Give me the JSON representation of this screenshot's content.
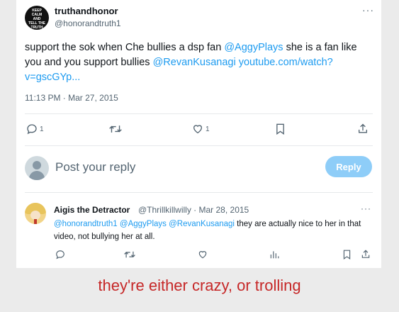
{
  "tweet": {
    "avatar_lines": [
      "KEEP",
      "CALM",
      "AND",
      "TELL THE",
      "TRUTH"
    ],
    "display_name": "truthandhonor",
    "handle": "@honorandtruth1",
    "more": "···",
    "text_1": "support the sok when Che bullies a dsp fan ",
    "mention_1": "@AggyPlays",
    "text_2": " she is a fan like you and you support bullies ",
    "mention_2": "@RevanKusanagi",
    "text_3": "  ",
    "url": "youtube.com/watch?v=gscGYp...",
    "timestamp": "11:13 PM · Mar 27, 2015",
    "reply_count": "1",
    "like_count": "1",
    "icons": [
      "reply-icon",
      "retweet-icon",
      "like-icon",
      "bookmark-icon",
      "share-icon"
    ]
  },
  "composer": {
    "placeholder": "Post your reply",
    "button_label": "Reply",
    "button_color": "#8ecdf8"
  },
  "reply": {
    "display_name": "Aigis the Detractor",
    "handle_time": "@Thrillkillwilly · Mar 28, 2015",
    "more": "···",
    "mention_1": "@honorandtruth1",
    "mention_2": "@AggyPlays",
    "mention_3": "@RevanKusanagi",
    "text": " they are actually nice to her in that video, not bullying her at all.",
    "icons": [
      "reply-icon",
      "retweet-icon",
      "like-icon",
      "views-icon",
      "bookmark-icon",
      "share-icon"
    ]
  },
  "caption": "they're either crazy, or trolling",
  "colors": {
    "link": "#1d9bf0",
    "caption": "#c62828",
    "muted": "#536471"
  }
}
